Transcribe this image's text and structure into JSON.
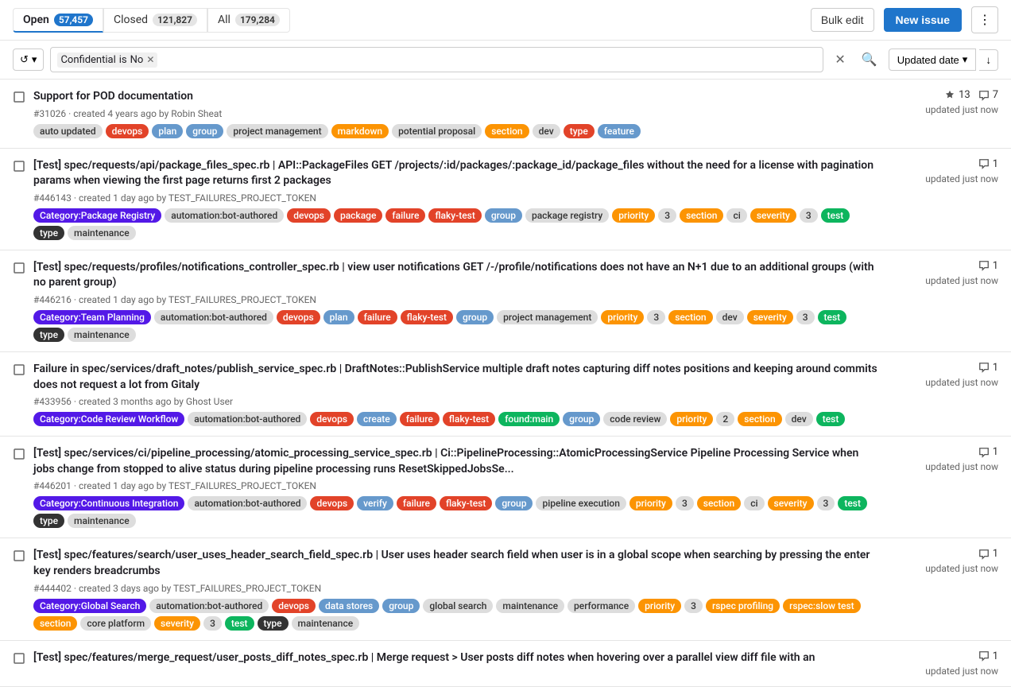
{
  "tabs": [
    {
      "id": "open",
      "label": "Open",
      "count": "57,457",
      "active": true
    },
    {
      "id": "closed",
      "label": "Closed",
      "count": "121,827",
      "active": false
    },
    {
      "id": "all",
      "label": "All",
      "count": "179,284",
      "active": false
    }
  ],
  "toolbar": {
    "bulk_edit_label": "Bulk edit",
    "new_issue_label": "New issue",
    "more_icon": "⋮"
  },
  "filter": {
    "history_icon": "↺",
    "chevron_icon": "▾",
    "token_key": "Confidential",
    "token_operator": "is",
    "token_value": "No",
    "clear_icon": "✕",
    "search_icon": "🔍"
  },
  "sort": {
    "label": "Updated date",
    "chevron": "▾",
    "direction_icon": "↓"
  },
  "issues": [
    {
      "id": 1,
      "number": "#31026",
      "icon": "□",
      "title": "Support for POD documentation",
      "meta": "created 4 years ago by Robin Sheat",
      "stats": [
        {
          "icon": "👍",
          "count": "13"
        },
        {
          "icon": "💬",
          "count": "7"
        }
      ],
      "updated": "updated just now",
      "labels": [
        {
          "text": "auto updated",
          "class": "label-auto-updated"
        },
        {
          "text": "devops",
          "class": "label-devops"
        },
        {
          "text": "plan",
          "class": "label-plan"
        },
        {
          "text": "group",
          "class": "label-group"
        },
        {
          "text": "project management",
          "class": "label-project-management"
        },
        {
          "text": "markdown",
          "class": "label-markdown"
        },
        {
          "text": "potential proposal",
          "class": "label-potential-proposal"
        },
        {
          "text": "section",
          "class": "label-section"
        },
        {
          "text": "dev",
          "class": "label-dev"
        },
        {
          "text": "type",
          "class": "label-type"
        },
        {
          "text": "feature",
          "class": "label-feature"
        }
      ]
    },
    {
      "id": 2,
      "number": "#446143",
      "icon": "□",
      "title": "[Test] spec/requests/api/package_files_spec.rb | API::PackageFiles GET /projects/:id/packages/:package_id/package_files without the need for a license with pagination params when viewing the first page returns first 2 packages",
      "meta": "created 1 day ago by TEST_FAILURES_PROJECT_TOKEN",
      "stats": [
        {
          "icon": "💬",
          "count": "1"
        }
      ],
      "updated": "updated just now",
      "labels": [
        {
          "text": "Category:Package Registry",
          "class": "label-category-package"
        },
        {
          "text": "automation:bot-authored",
          "class": "label-automation"
        },
        {
          "text": "devops",
          "class": "label-devops"
        },
        {
          "text": "package",
          "class": "label-package"
        },
        {
          "text": "failure",
          "class": "label-failure"
        },
        {
          "text": "flaky-test",
          "class": "label-flaky-test"
        },
        {
          "text": "group",
          "class": "label-group"
        },
        {
          "text": "package registry",
          "class": "label-package-registry"
        },
        {
          "text": "priority",
          "class": "label-priority"
        },
        {
          "text": "3",
          "class": "label-priority-num"
        },
        {
          "text": "section",
          "class": "label-section"
        },
        {
          "text": "ci",
          "class": "label-ci"
        },
        {
          "text": "severity",
          "class": "label-severity"
        },
        {
          "text": "3",
          "class": "label-severity-num"
        },
        {
          "text": "test",
          "class": "label-test"
        },
        {
          "text": "type",
          "class": "label-type-dark"
        },
        {
          "text": "maintenance",
          "class": "label-maintenance"
        }
      ]
    },
    {
      "id": 3,
      "number": "#446216",
      "icon": "□",
      "title": "[Test] spec/requests/profiles/notifications_controller_spec.rb | view user notifications GET /-/profile/notifications does not have an N+1 due to an additional groups (with no parent group)",
      "meta": "created 1 day ago by TEST_FAILURES_PROJECT_TOKEN",
      "stats": [
        {
          "icon": "💬",
          "count": "1"
        }
      ],
      "updated": "updated just now",
      "labels": [
        {
          "text": "Category:Team Planning",
          "class": "label-category-team"
        },
        {
          "text": "automation:bot-authored",
          "class": "label-automation"
        },
        {
          "text": "devops",
          "class": "label-devops"
        },
        {
          "text": "plan",
          "class": "label-plan"
        },
        {
          "text": "failure",
          "class": "label-failure"
        },
        {
          "text": "flaky-test",
          "class": "label-flaky-test"
        },
        {
          "text": "group",
          "class": "label-group"
        },
        {
          "text": "project management",
          "class": "label-project-management"
        },
        {
          "text": "priority",
          "class": "label-priority"
        },
        {
          "text": "3",
          "class": "label-priority-num"
        },
        {
          "text": "section",
          "class": "label-section"
        },
        {
          "text": "dev",
          "class": "label-dev"
        },
        {
          "text": "severity",
          "class": "label-severity"
        },
        {
          "text": "3",
          "class": "label-severity-num"
        },
        {
          "text": "test",
          "class": "label-test"
        },
        {
          "text": "type",
          "class": "label-type-dark"
        },
        {
          "text": "maintenance",
          "class": "label-maintenance"
        }
      ]
    },
    {
      "id": 4,
      "number": "#433956",
      "icon": "□",
      "title": "Failure in spec/services/draft_notes/publish_service_spec.rb | DraftNotes::PublishService multiple draft notes capturing diff notes positions and keeping around commits does not request a lot from Gitaly",
      "meta": "created 3 months ago by Ghost User",
      "stats": [
        {
          "icon": "💬",
          "count": "1"
        }
      ],
      "updated": "updated just now",
      "labels": [
        {
          "text": "Category:Code Review Workflow",
          "class": "label-code-review"
        },
        {
          "text": "automation:bot-authored",
          "class": "label-automation"
        },
        {
          "text": "devops",
          "class": "label-devops"
        },
        {
          "text": "create",
          "class": "label-create"
        },
        {
          "text": "failure",
          "class": "label-failure"
        },
        {
          "text": "flaky-test",
          "class": "label-flaky-test"
        },
        {
          "text": "found:main",
          "class": "label-found-main"
        },
        {
          "text": "group",
          "class": "label-group"
        },
        {
          "text": "code review",
          "class": "label-code-review-text"
        },
        {
          "text": "priority",
          "class": "label-priority-2"
        },
        {
          "text": "2",
          "class": "label-priority-2-num"
        },
        {
          "text": "section",
          "class": "label-section"
        },
        {
          "text": "dev",
          "class": "label-dev"
        },
        {
          "text": "test",
          "class": "label-test"
        }
      ]
    },
    {
      "id": 5,
      "number": "#446201",
      "icon": "□",
      "title": "[Test] spec/services/ci/pipeline_processing/atomic_processing_service_spec.rb | Ci::PipelineProcessing::AtomicProcessingService Pipeline Processing Service when jobs change from stopped to alive status during pipeline processing runs ResetSkippedJobsSe...",
      "meta": "created 1 day ago by TEST_FAILURES_PROJECT_TOKEN",
      "stats": [
        {
          "icon": "💬",
          "count": "1"
        }
      ],
      "updated": "updated just now",
      "labels": [
        {
          "text": "Category:Continuous Integration",
          "class": "label-category-ci"
        },
        {
          "text": "automation:bot-authored",
          "class": "label-automation"
        },
        {
          "text": "devops",
          "class": "label-devops"
        },
        {
          "text": "verify",
          "class": "label-verify"
        },
        {
          "text": "failure",
          "class": "label-failure"
        },
        {
          "text": "flaky-test",
          "class": "label-flaky-test"
        },
        {
          "text": "group",
          "class": "label-group"
        },
        {
          "text": "pipeline execution",
          "class": "label-pipeline-ex"
        },
        {
          "text": "priority",
          "class": "label-priority"
        },
        {
          "text": "3",
          "class": "label-priority-num"
        },
        {
          "text": "section",
          "class": "label-section"
        },
        {
          "text": "ci",
          "class": "label-ci"
        },
        {
          "text": "severity",
          "class": "label-severity"
        },
        {
          "text": "3",
          "class": "label-severity-num"
        },
        {
          "text": "test",
          "class": "label-test"
        },
        {
          "text": "type",
          "class": "label-type-dark"
        },
        {
          "text": "maintenance",
          "class": "label-maintenance"
        }
      ]
    },
    {
      "id": 6,
      "number": "#444402",
      "icon": "□",
      "title": "[Test] spec/features/search/user_uses_header_search_field_spec.rb | User uses header search field when user is in a global scope when searching by pressing the enter key renders breadcrumbs",
      "meta": "created 3 days ago by TEST_FAILURES_PROJECT_TOKEN",
      "stats": [
        {
          "icon": "💬",
          "count": "1"
        }
      ],
      "updated": "updated just now",
      "labels": [
        {
          "text": "Category:Global Search",
          "class": "label-category-global"
        },
        {
          "text": "automation:bot-authored",
          "class": "label-automation"
        },
        {
          "text": "devops",
          "class": "label-devops"
        },
        {
          "text": "data stores",
          "class": "label-data-stores"
        },
        {
          "text": "group",
          "class": "label-group"
        },
        {
          "text": "global search",
          "class": "label-global-search"
        },
        {
          "text": "maintenance",
          "class": "label-maint-perf"
        },
        {
          "text": "performance",
          "class": "label-performance"
        },
        {
          "text": "priority",
          "class": "label-priority"
        },
        {
          "text": "3",
          "class": "label-priority-num"
        },
        {
          "text": "rspec profiling",
          "class": "label-rspec-profiling"
        },
        {
          "text": "rspec:slow test",
          "class": "label-rspec-slow"
        },
        {
          "text": "section",
          "class": "label-section-orange"
        },
        {
          "text": "core platform",
          "class": "label-core-platform"
        },
        {
          "text": "severity",
          "class": "label-severity"
        },
        {
          "text": "3",
          "class": "label-severity-num"
        },
        {
          "text": "test",
          "class": "label-test"
        },
        {
          "text": "type",
          "class": "label-type-dark"
        },
        {
          "text": "maintenance",
          "class": "label-maintenance"
        }
      ]
    },
    {
      "id": 7,
      "number": "",
      "icon": "□",
      "title": "[Test] spec/features/merge_request/user_posts_diff_notes_spec.rb | Merge request > User posts diff notes when hovering over a parallel view diff file with an",
      "meta": "",
      "stats": [
        {
          "icon": "💬",
          "count": "1"
        }
      ],
      "updated": "updated just now",
      "labels": []
    }
  ]
}
